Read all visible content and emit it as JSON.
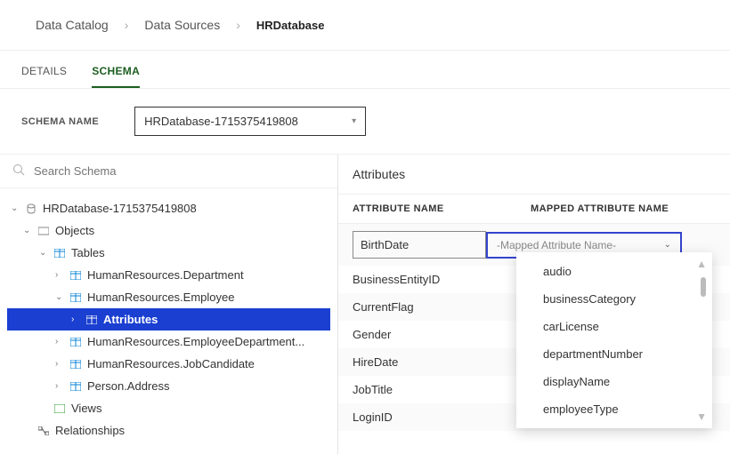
{
  "breadcrumb": {
    "root": "Data Catalog",
    "mid": "Data Sources",
    "current": "HRDatabase"
  },
  "tabs": {
    "details": "DETAILS",
    "schema": "SCHEMA"
  },
  "schemaName": {
    "label": "SCHEMA NAME",
    "value": "HRDatabase-1715375419808"
  },
  "search": {
    "placeholder": "Search Schema"
  },
  "tree": {
    "root": "HRDatabase-1715375419808",
    "objects": "Objects",
    "tables": "Tables",
    "tableItems": [
      "HumanResources.Department",
      "HumanResources.Employee",
      "HumanResources.EmployeeDepartment...",
      "HumanResources.JobCandidate",
      "Person.Address"
    ],
    "attributes": "Attributes",
    "views": "Views",
    "relationships": "Relationships"
  },
  "rightPanel": {
    "title": "Attributes",
    "col1": "ATTRIBUTE NAME",
    "col2": "MAPPED ATTRIBUTE NAME",
    "mappedPlaceholder": "-Mapped Attribute Name-",
    "rows": [
      "BirthDate",
      "BusinessEntityID",
      "CurrentFlag",
      "Gender",
      "HireDate",
      "JobTitle",
      "LoginID"
    ]
  },
  "dropdown": {
    "options": [
      "audio",
      "businessCategory",
      "carLicense",
      "departmentNumber",
      "displayName",
      "employeeType"
    ]
  }
}
